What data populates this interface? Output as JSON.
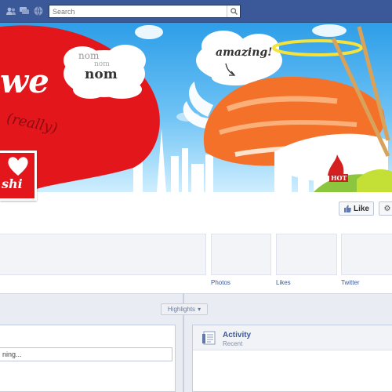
{
  "topbar": {
    "icons": [
      "friend-requests-icon",
      "messages-icon",
      "notifications-icon"
    ],
    "search": {
      "placeholder": "Search",
      "value": ""
    }
  },
  "cover": {
    "nom_big": "nom",
    "nom_small": "nom",
    "nom_bold": "nom",
    "amazing": "amazing!",
    "love_fragment": "we",
    "really": "(really)",
    "hot_badge": "HOT"
  },
  "profile": {
    "picture_text": "shi"
  },
  "actions": {
    "like_label": "Like"
  },
  "tabs": [
    {
      "label": "Photos"
    },
    {
      "label": "Likes"
    },
    {
      "label": "Twitter"
    }
  ],
  "timeline": {
    "highlights_label": "Highlights",
    "status_placeholder": "ning...",
    "activity": {
      "title": "Activity",
      "subtitle": "Recent"
    }
  },
  "colors": {
    "brand": "#3b5998",
    "heart": "#e3161c",
    "sky": "#2d9ee8"
  }
}
